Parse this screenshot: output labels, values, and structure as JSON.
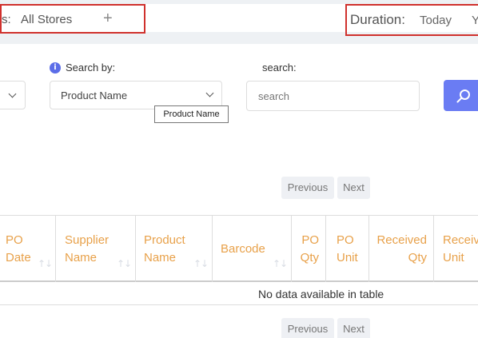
{
  "filters": {
    "stores_label": "s:",
    "stores_value": "All Stores",
    "add_store": "+",
    "duration_label": "Duration:",
    "duration_today": "Today",
    "duration_next": "Y"
  },
  "search_panel": {
    "info_icon": "i",
    "search_by_label": "Search by:",
    "search_by_value": "Product Name",
    "tooltip": "Product Name",
    "search_label": "search:",
    "search_placeholder": "search"
  },
  "pagination": {
    "previous": "Previous",
    "next": "Next"
  },
  "table": {
    "columns": [
      {
        "label": "PO\nDate",
        "sortable": true
      },
      {
        "label": "Supplier\nName",
        "sortable": true
      },
      {
        "label": "Product\nName",
        "sortable": true
      },
      {
        "label": "Barcode",
        "sortable": true
      },
      {
        "label": "PO\nQty",
        "sortable": false
      },
      {
        "label": "PO\nUnit",
        "sortable": false
      },
      {
        "label": "Received\nQty",
        "sortable": false
      },
      {
        "label": "Receiv\nUnit",
        "sortable": false
      }
    ],
    "empty_message": "No data available in table"
  },
  "colors": {
    "accent": "#6a7cf3",
    "header_text": "#e8a14a",
    "highlight_border": "#d0312d"
  }
}
